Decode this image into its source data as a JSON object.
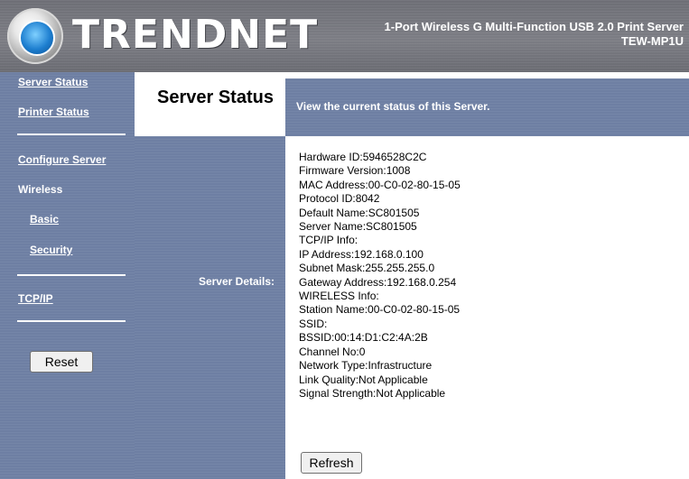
{
  "header": {
    "brand": "TRENDNET",
    "product_line1": "1-Port Wireless G Multi-Function USB 2.0 Print Server",
    "product_line2": "TEW-MP1U"
  },
  "sidebar": {
    "server_status": "Server Status",
    "printer_status": "Printer Status",
    "configure_server": "Configure Server",
    "wireless": "Wireless",
    "basic": "Basic",
    "security": "Security",
    "tcpip": "TCP/IP",
    "reset_label": "Reset"
  },
  "main": {
    "title": "Server Status",
    "description": "View the current status of this Server.",
    "details_label": "Server Details:",
    "details": [
      "Hardware ID:5946528C2C",
      "Firmware Version:1008",
      "MAC Address:00-C0-02-80-15-05",
      "Protocol ID:8042",
      "Default Name:SC801505",
      "Server Name:SC801505",
      "TCP/IP Info:",
      "IP Address:192.168.0.100",
      "Subnet Mask:255.255.255.0",
      "Gateway Address:192.168.0.254",
      "WIRELESS Info:",
      "Station Name:00-C0-02-80-15-05",
      "SSID:",
      "BSSID:00:14:D1:C2:4A:2B",
      "Channel No:0",
      "Network Type:Infrastructure",
      "Link Quality:Not Applicable",
      "Signal Strength:Not Applicable"
    ],
    "refresh_label": "Refresh"
  },
  "colors": {
    "header_bg": "#75767d",
    "sidebar_bg": "#6e7fa3",
    "text_on_dark": "#ffffff"
  }
}
